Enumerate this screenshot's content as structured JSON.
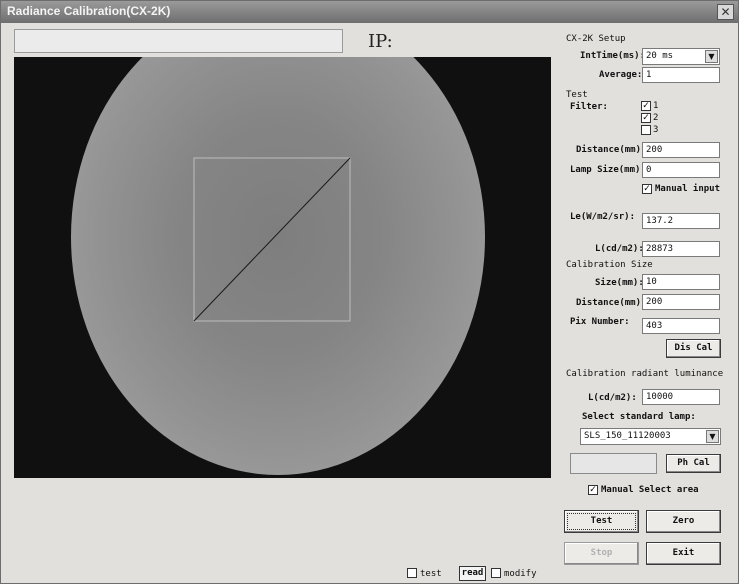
{
  "window": {
    "title": "Radiance Calibration(CX-2K)"
  },
  "header": {
    "path_value": "",
    "ip_label": "IP:"
  },
  "setup": {
    "section_label": "CX-2K Setup",
    "inttime_label": "IntTime(ms):",
    "inttime_value": "20 ms",
    "average_label": "Average:",
    "average_value": "1"
  },
  "test": {
    "section_label": "Test",
    "filter_label": "Filter:",
    "filters": [
      {
        "label": "1",
        "checked": true
      },
      {
        "label": "2",
        "checked": true
      },
      {
        "label": "3",
        "checked": false
      }
    ],
    "distance_label": "Distance(mm):",
    "distance_value": "200",
    "lamp_size_label": "Lamp Size(mm):",
    "lamp_size_value": "0",
    "manual_input_label": "Manual input",
    "manual_input_checked": true,
    "le_label": "Le(W/m2/sr):",
    "le_value": "137.2",
    "l_label": "L(cd/m2):",
    "l_value": "28873"
  },
  "calibration_size": {
    "section_label": "Calibration Size",
    "size_label": "Size(mm):",
    "size_value": "10",
    "distance_label": "Distance(mm):",
    "distance_value": "200",
    "pix_number_label": "Pix Number:",
    "pix_number_value": "403",
    "dis_cal_button": "Dis Cal"
  },
  "radiant": {
    "section_label": "Calibration radiant luminance",
    "l_label": "L(cd/m2):",
    "l_value": "10000",
    "select_lamp_label": "Select standard lamp:",
    "lamp_value": "SLS_150_11120003",
    "ph_cal_button": "Ph Cal",
    "manual_select_label": "Manual Select area",
    "manual_select_checked": true
  },
  "buttons": {
    "test": "Test",
    "zero": "Zero",
    "stop": "Stop",
    "exit": "Exit"
  },
  "bottom": {
    "test_label": "test",
    "read_label": "read",
    "modify_label": "modify"
  },
  "colors": {
    "window_bg": "#e2e0dc",
    "image_bg": "#101010",
    "disk": "#8a8a8a"
  }
}
